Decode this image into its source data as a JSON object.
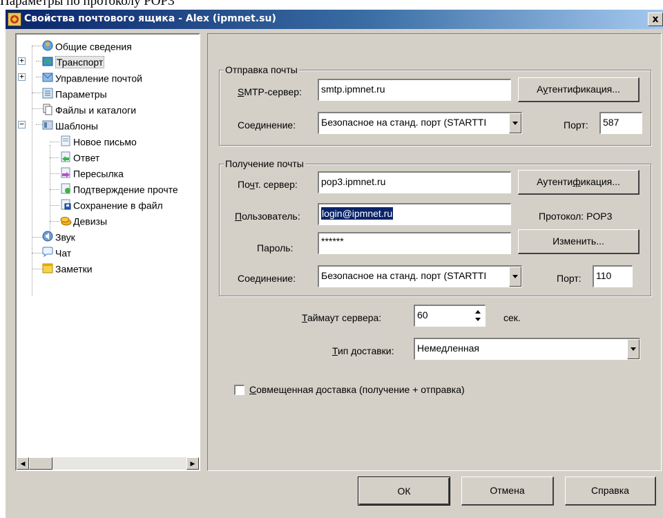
{
  "caption": "Параметры по протоколу POP3",
  "window": {
    "title": "Свойства почтового ящика - Alex (ipmnet.su)",
    "close_label": "x"
  },
  "tree": {
    "items": [
      {
        "label": "Общие сведения",
        "icon": "info-icon"
      },
      {
        "label": "Транспорт",
        "icon": "transport-icon",
        "selected": true
      },
      {
        "label": "Управление почтой",
        "icon": "mail-management-icon"
      },
      {
        "label": "Параметры",
        "icon": "parameters-icon"
      },
      {
        "label": "Файлы и каталоги",
        "icon": "files-icon"
      },
      {
        "label": "Шаблоны",
        "icon": "templates-icon"
      },
      {
        "label": "Новое письмо",
        "icon": "new-letter-icon"
      },
      {
        "label": "Ответ",
        "icon": "reply-icon"
      },
      {
        "label": "Пересылка",
        "icon": "forward-icon"
      },
      {
        "label": "Подтверждение прочте",
        "icon": "read-receipt-icon"
      },
      {
        "label": "Сохранение в файл",
        "icon": "save-to-file-icon"
      },
      {
        "label": "Девизы",
        "icon": "mottos-icon"
      },
      {
        "label": "Звук",
        "icon": "sound-icon"
      },
      {
        "label": "Чат",
        "icon": "chat-icon"
      },
      {
        "label": "Заметки",
        "icon": "notes-icon"
      }
    ]
  },
  "send": {
    "legend": "Отправка почты",
    "smtp_label_pre": "",
    "smtp_label_u": "S",
    "smtp_label_post": "MTP-сервер:",
    "smtp_value": "smtp.ipmnet.ru",
    "auth_pre": "А",
    "auth_u": "у",
    "auth_post": "тентификация...",
    "connection_label": "Соединение:",
    "connection_value": "Безопасное на станд. порт (STARTTI",
    "port_label": "Порт:",
    "port_value": "587"
  },
  "receive": {
    "legend": "Получение почты",
    "server_pre": "По",
    "server_u": "ч",
    "server_post": "т. сервер:",
    "server_value": "pop3.ipmnet.ru",
    "auth_pre": "Аутенти",
    "auth_u": "ф",
    "auth_post": "икация...",
    "user_pre": "",
    "user_u": "П",
    "user_post": "ользователь:",
    "user_value": "login@ipmnet.ru",
    "protocol_label": "Протокол:",
    "protocol_value": "POP3",
    "password_label": "Пароль:",
    "password_value": "******",
    "change_label": "Изменить...",
    "connection_label": "Соединение:",
    "connection_value": "Безопасное на станд. порт (STARTTI",
    "port_label": "Порт:",
    "port_value": "110"
  },
  "timeout": {
    "label_u": "Т",
    "label_post": "аймаут сервера:",
    "value": "60",
    "unit": "сек."
  },
  "delivery": {
    "label_u": "Т",
    "label_post": "ип доставки:",
    "value": "Немедленная"
  },
  "combined": {
    "label_u": "С",
    "label_post": "овмещенная доставка (получение + отправка)",
    "checked": false
  },
  "buttons": {
    "ok": "ОК",
    "cancel": "Отмена",
    "help": "Справка"
  }
}
